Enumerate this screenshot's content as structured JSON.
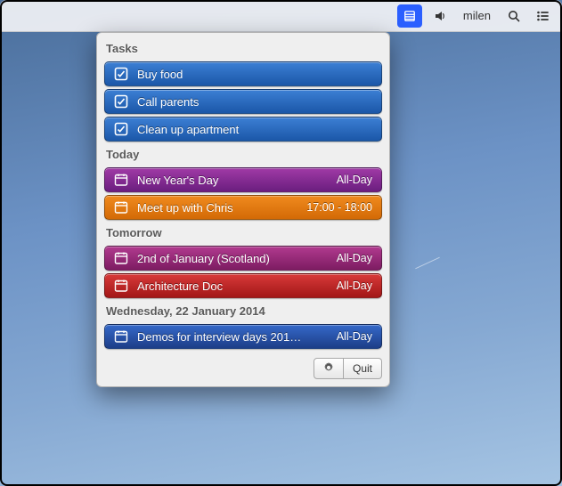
{
  "menubar": {
    "username": "milen"
  },
  "sections": [
    {
      "header": "Tasks",
      "items": [
        {
          "kind": "task",
          "title": "Buy food",
          "time": "",
          "color": "c-blue"
        },
        {
          "kind": "task",
          "title": "Call parents",
          "time": "",
          "color": "c-blue"
        },
        {
          "kind": "task",
          "title": "Clean up apartment",
          "time": "",
          "color": "c-blue"
        }
      ]
    },
    {
      "header": "Today",
      "items": [
        {
          "kind": "event",
          "title": "New Year's Day",
          "time": "All-Day",
          "color": "c-purple"
        },
        {
          "kind": "event",
          "title": "Meet up with Chris",
          "time": "17:00 - 18:00",
          "color": "c-orange"
        }
      ]
    },
    {
      "header": "Tomorrow",
      "items": [
        {
          "kind": "event",
          "title": "2nd of January (Scotland)",
          "time": "All-Day",
          "color": "c-magenta"
        },
        {
          "kind": "event",
          "title": "Architecture Doc",
          "time": "All-Day",
          "color": "c-red"
        }
      ]
    },
    {
      "header": "Wednesday, 22 January 2014",
      "items": [
        {
          "kind": "event",
          "title": "Demos for interview days 201…",
          "time": "All-Day",
          "color": "c-bluedk"
        }
      ]
    }
  ],
  "footer": {
    "quit": "Quit"
  }
}
